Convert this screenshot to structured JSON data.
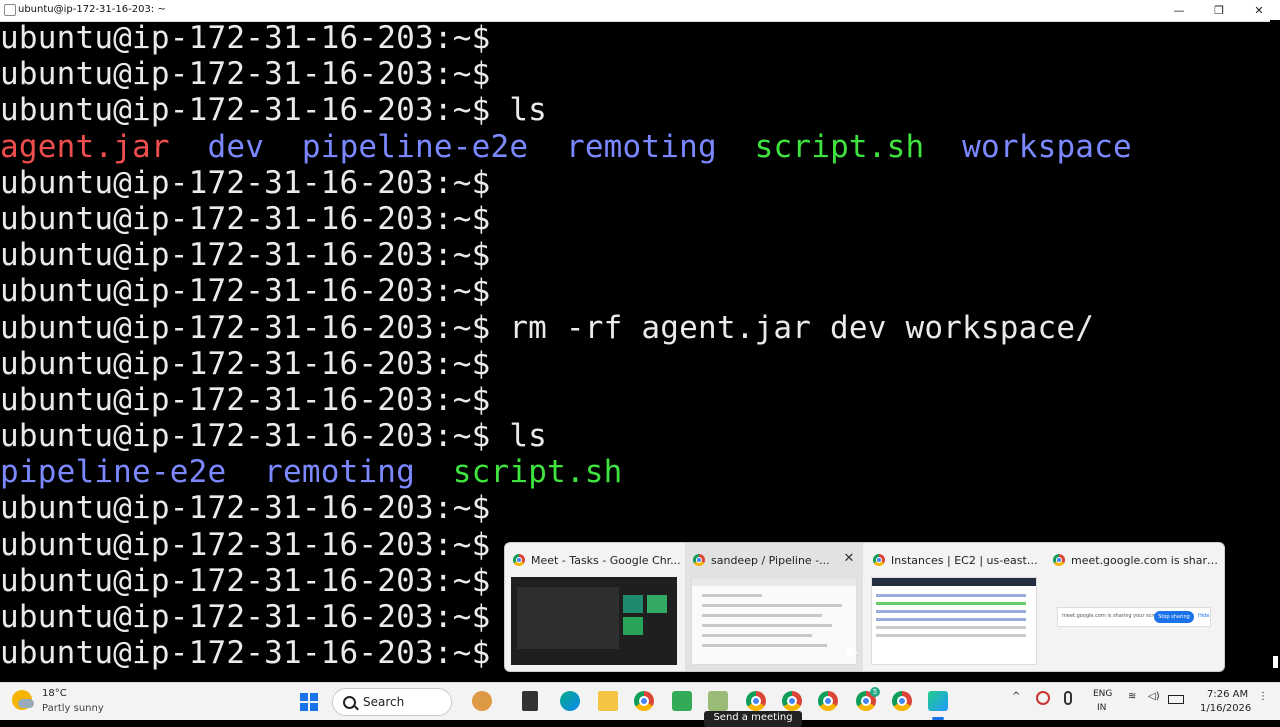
{
  "window": {
    "title": "ubuntu@ip-172-31-16-203: ~",
    "minimize": "—",
    "maximize": "❐",
    "close": "✕"
  },
  "terminal": {
    "prompt": "ubuntu@ip-172-31-16-203:~$",
    "lines": [
      {
        "text": "ubuntu@ip-172-31-16-203:~$"
      },
      {
        "text": "ubuntu@ip-172-31-16-203:~$"
      },
      {
        "text": "ubuntu@ip-172-31-16-203:~$ ls"
      },
      {
        "parts": [
          {
            "t": "agent.jar",
            "c": "red"
          },
          {
            "t": "  "
          },
          {
            "t": "dev",
            "c": "blue"
          },
          {
            "t": "  "
          },
          {
            "t": "pipeline-e2e",
            "c": "blue"
          },
          {
            "t": "  "
          },
          {
            "t": "remoting",
            "c": "blue"
          },
          {
            "t": "  "
          },
          {
            "t": "script.sh",
            "c": "green"
          },
          {
            "t": "  "
          },
          {
            "t": "workspace",
            "c": "blue"
          }
        ]
      },
      {
        "text": "ubuntu@ip-172-31-16-203:~$"
      },
      {
        "text": "ubuntu@ip-172-31-16-203:~$"
      },
      {
        "text": "ubuntu@ip-172-31-16-203:~$"
      },
      {
        "text": "ubuntu@ip-172-31-16-203:~$"
      },
      {
        "text": "ubuntu@ip-172-31-16-203:~$ rm -rf agent.jar dev workspace/"
      },
      {
        "text": "ubuntu@ip-172-31-16-203:~$"
      },
      {
        "text": "ubuntu@ip-172-31-16-203:~$"
      },
      {
        "text": "ubuntu@ip-172-31-16-203:~$ ls"
      },
      {
        "parts": [
          {
            "t": "pipeline-e2e",
            "c": "blue"
          },
          {
            "t": "  "
          },
          {
            "t": "remoting",
            "c": "blue"
          },
          {
            "t": "  "
          },
          {
            "t": "script.sh",
            "c": "green"
          }
        ]
      },
      {
        "text": "ubuntu@ip-172-31-16-203:~$"
      },
      {
        "text": "ubuntu@ip-172-31-16-203:~$"
      },
      {
        "text": "ubuntu@ip-172-31-16-203:~$"
      },
      {
        "text": "ubuntu@ip-172-31-16-203:~$"
      },
      {
        "text": "ubuntu@ip-172-31-16-203:~$"
      }
    ],
    "colors": {
      "red": "#f04e4e",
      "blue": "#7b88ff",
      "green": "#3fe33f",
      "default": "#eaeaea"
    }
  },
  "previews": [
    {
      "title": "Meet - Tasks - Google Chr...",
      "icon": "chrome-icon"
    },
    {
      "title": "sandeep / Pipeline -...",
      "icon": "chrome-icon",
      "close": "✕"
    },
    {
      "title": "Instances | EC2 | us-east-1...",
      "icon": "chrome-icon"
    },
    {
      "title": "meet.google.com is sharin...",
      "icon": "chrome-icon"
    }
  ],
  "share_bar": {
    "text": "meet.google.com is sharing your screen.",
    "stop_label": "Stop sharing",
    "hide_label": "Hide"
  },
  "taskbar": {
    "weather_temp": "18°C",
    "weather_desc": "Partly sunny",
    "search_label": "Search",
    "tooltip": "Send a meeting",
    "lang_line1": "ENG",
    "lang_line2": "IN",
    "time": "7:26 AM",
    "date": "1/16/2026",
    "badge": "5"
  }
}
